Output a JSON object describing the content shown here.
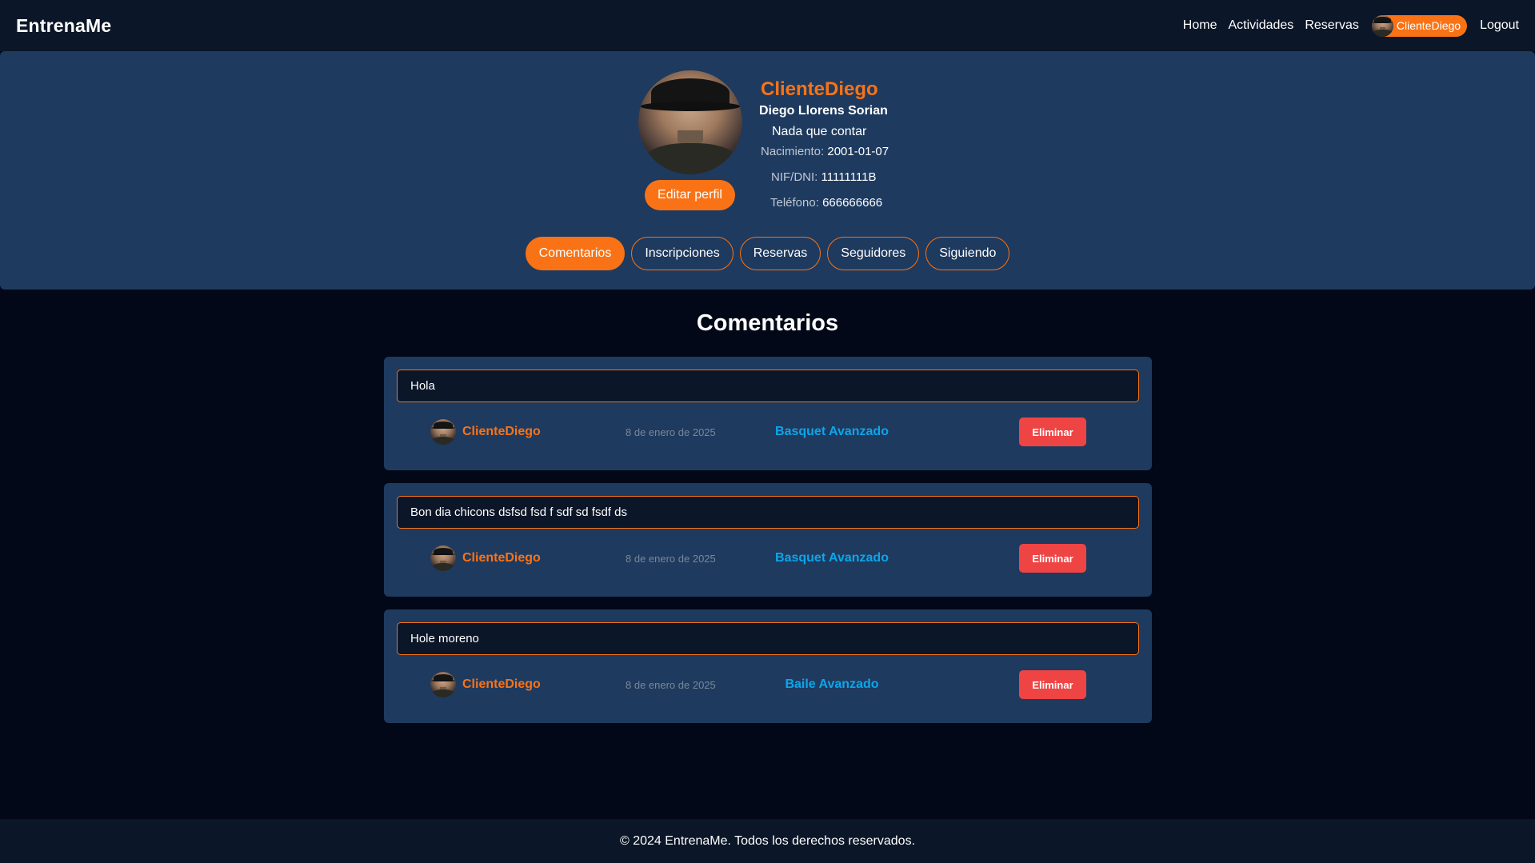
{
  "navbar": {
    "brand": "EntrenaMe",
    "links": [
      "Home",
      "Actividades",
      "Reservas"
    ],
    "user_label": "ClienteDiego",
    "logout": "Logout"
  },
  "profile": {
    "username": "ClienteDiego",
    "full_name": "Diego Llorens Sorian",
    "bio": "Nada que contar",
    "birth_label": "Nacimiento:",
    "birth_value": "2001-01-07",
    "nif_label": "NIF/DNI:",
    "nif_value": "11111111B",
    "phone_label": "Teléfono:",
    "phone_value": "666666666",
    "edit_button": "Editar perfil"
  },
  "tabs": [
    "Comentarios",
    "Inscripciones",
    "Reservas",
    "Seguidores",
    "Siguiendo"
  ],
  "active_tab": "Comentarios",
  "section_title": "Comentarios",
  "comments": [
    {
      "text": "Hola",
      "author": "ClienteDiego",
      "date": "8 de enero de 2025",
      "activity": "Basquet Avanzado",
      "delete_label": "Eliminar"
    },
    {
      "text": "Bon dia chicons dsfsd fsd f sdf sd fsdf ds",
      "author": "ClienteDiego",
      "date": "8 de enero de 2025",
      "activity": "Basquet Avanzado",
      "delete_label": "Eliminar"
    },
    {
      "text": "Hole moreno",
      "author": "ClienteDiego",
      "date": "8 de enero de 2025",
      "activity": "Baile Avanzado",
      "delete_label": "Eliminar"
    }
  ],
  "footer": "© 2024 EntrenaMe. Todos los derechos reservados.",
  "colors": {
    "accent": "#f97316",
    "panel": "#1e3a5f",
    "background": "#020817",
    "link": "#0ea5e9",
    "danger": "#ef4444"
  }
}
